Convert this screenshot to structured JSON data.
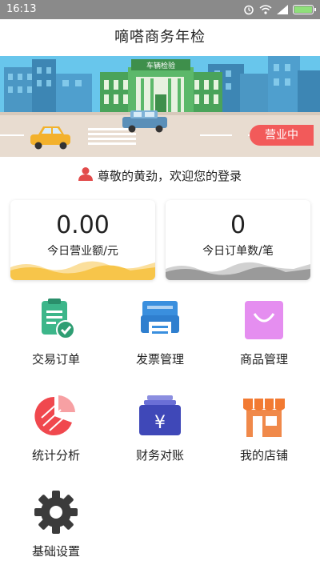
{
  "status_bar": {
    "time": "16:13",
    "icons": [
      "alarm-icon",
      "wifi-icon",
      "signal-icon",
      "battery-icon"
    ]
  },
  "header": {
    "title": "嘀嗒商务年检"
  },
  "banner": {
    "building_sign": "车辆检验",
    "status_badge": "营业中",
    "colors": {
      "sky": "#68c6ec",
      "road": "#e8dcd0",
      "badge": "#f25a5a"
    }
  },
  "greeting": {
    "text": "尊敬的黄劲，欢迎您的登录",
    "icon": "user-icon"
  },
  "stats": [
    {
      "value": "0.00",
      "label": "今日营业额/元",
      "wave_color": "#f7c54a"
    },
    {
      "value": "0",
      "label": "今日订单数/笔",
      "wave_color": "#9a9a9a"
    }
  ],
  "menu": [
    {
      "label": "交易订单",
      "icon": "transaction-order-icon"
    },
    {
      "label": "发票管理",
      "icon": "invoice-printer-icon"
    },
    {
      "label": "商品管理",
      "icon": "shopping-bag-icon"
    },
    {
      "label": "统计分析",
      "icon": "pie-chart-icon"
    },
    {
      "label": "财务对账",
      "icon": "finance-yen-icon"
    },
    {
      "label": "我的店铺",
      "icon": "shop-icon"
    },
    {
      "label": "基础设置",
      "icon": "gear-icon"
    }
  ]
}
